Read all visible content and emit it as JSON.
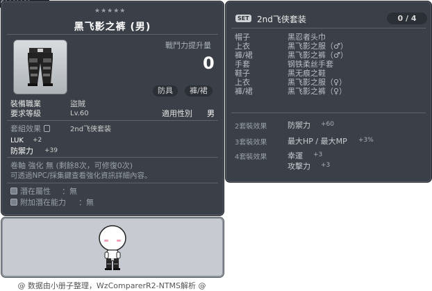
{
  "item_id": "01060089",
  "stars": "★★★★★",
  "title": "黑飞影之裤 (男)",
  "attack_increase_label": "戰鬥力提升量",
  "attack_increase_value": "0",
  "category_pills": [
    "防具",
    "褲/裙"
  ],
  "info": {
    "job_label": "裝備職業",
    "job_value": "盜賊",
    "level_label": "要求等級",
    "level_value": "Lv.60",
    "gender_label": "適用性別",
    "gender_value": "男"
  },
  "set_effect_row": {
    "label": "套組效果",
    "value": "2nd飞侠套装"
  },
  "stats": [
    {
      "name": "LUK",
      "value": "+2"
    },
    {
      "name": "防禦力",
      "value": "+39"
    }
  ],
  "scroll_text": "卷軸 強化 無 (剩餘8次，可修復0次)",
  "npc_note": "可透過NPC/採集鍵查看強化資訊詳細內容。",
  "potential": [
    {
      "label": "潛在屬性",
      "value": "：無"
    },
    {
      "label": "附加潛在能力",
      "value": "：無"
    }
  ],
  "set_panel": {
    "badge": "SET",
    "name": "2nd飞侠套装",
    "count": "0 / 4",
    "items": [
      {
        "slot": "帽子",
        "name": "黑忍者头巾"
      },
      {
        "slot": "上衣",
        "name": "黑飞影之服（♂）"
      },
      {
        "slot": "褲/裙",
        "name": "黑飞影之裤（♂）"
      },
      {
        "slot": "手套",
        "name": "钢铁柔丝手套"
      },
      {
        "slot": "鞋子",
        "name": "黑无痕之鞋"
      },
      {
        "slot": "上衣",
        "name": "黑飞影之服（♀）"
      },
      {
        "slot": "褲/裙",
        "name": "黑飞影之裤（♀）"
      }
    ],
    "effects": [
      {
        "label": "2套裝效果",
        "lines": [
          {
            "stat": "防禦力",
            "value": "+60"
          }
        ]
      },
      {
        "label": "3套裝效果",
        "lines": [
          {
            "stat": "最大HP / 最大MP",
            "value": "+3%"
          }
        ]
      },
      {
        "label": "4套裝效果",
        "lines": [
          {
            "stat": "幸運",
            "value": "+3"
          },
          {
            "stat": "攻擊力",
            "value": "+3"
          }
        ]
      }
    ]
  },
  "footer": "@ 数据由小册子整理，WzComparerR2-NTMS解析 @",
  "colors": {
    "panel_bg": "#3b4048",
    "panel_border": "#1d2026",
    "pill_bg": "#2b2f36"
  }
}
